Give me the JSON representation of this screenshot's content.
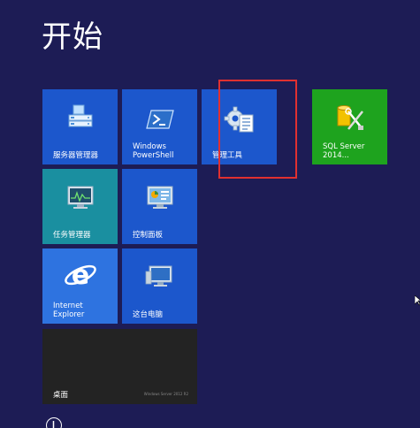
{
  "start": {
    "title": "开始"
  },
  "tiles": {
    "server_manager": "服务器管理器",
    "powershell": "Windows\nPowerShell",
    "admin_tools": "管理工具",
    "sql_server": "SQL Server\n2014...",
    "task_manager": "任务管理器",
    "control_panel": "控制面板",
    "ie": "Internet\nExplorer",
    "this_pc": "这台电脑",
    "desktop": "桌面",
    "desktop_watermark": "Windows Server 2012 R2"
  },
  "colors": {
    "background": "#1d1c55",
    "tile_blue": "#1c57cc",
    "tile_teal": "#1a8fa0",
    "tile_green": "#1ea31e",
    "tile_dark": "#232323",
    "highlight": "#e03030"
  },
  "icons": {
    "server_manager": "server-manager-icon",
    "powershell": "powershell-icon",
    "admin_tools": "admin-tools-gear-icon",
    "sql_server": "sql-server-tools-icon",
    "task_manager": "task-manager-monitor-icon",
    "control_panel": "control-panel-icon",
    "ie": "internet-explorer-icon",
    "this_pc": "computer-icon",
    "all_apps": "arrow-down-circle-icon"
  }
}
